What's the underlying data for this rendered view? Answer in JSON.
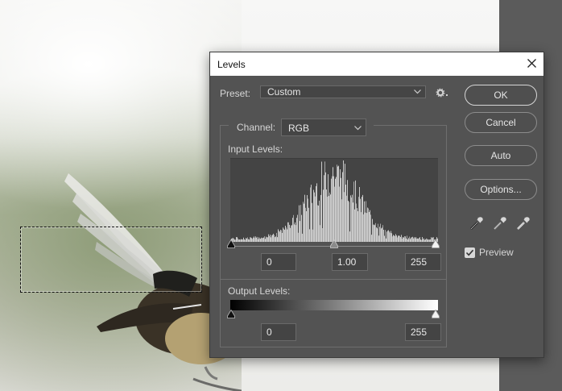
{
  "dialog": {
    "title": "Levels",
    "preset_label": "Preset:",
    "preset_value": "Custom",
    "channel_label": "Channel:",
    "channel_value": "RGB",
    "input_levels_label": "Input Levels:",
    "output_levels_label": "Output Levels:",
    "input_black": "0",
    "input_gamma": "1.00",
    "input_white": "255",
    "output_black": "0",
    "output_white": "255",
    "buttons": {
      "ok": "OK",
      "cancel": "Cancel",
      "auto": "Auto",
      "options": "Options..."
    },
    "preview_label": "Preview",
    "preview_checked": true,
    "icons": [
      "gear-icon",
      "black-eyedropper-icon",
      "gray-eyedropper-icon",
      "white-eyedropper-icon",
      "close-icon"
    ]
  },
  "colors": {
    "dialog_bg": "#535353",
    "field_bg": "#444444",
    "text": "#d6d6d6"
  }
}
